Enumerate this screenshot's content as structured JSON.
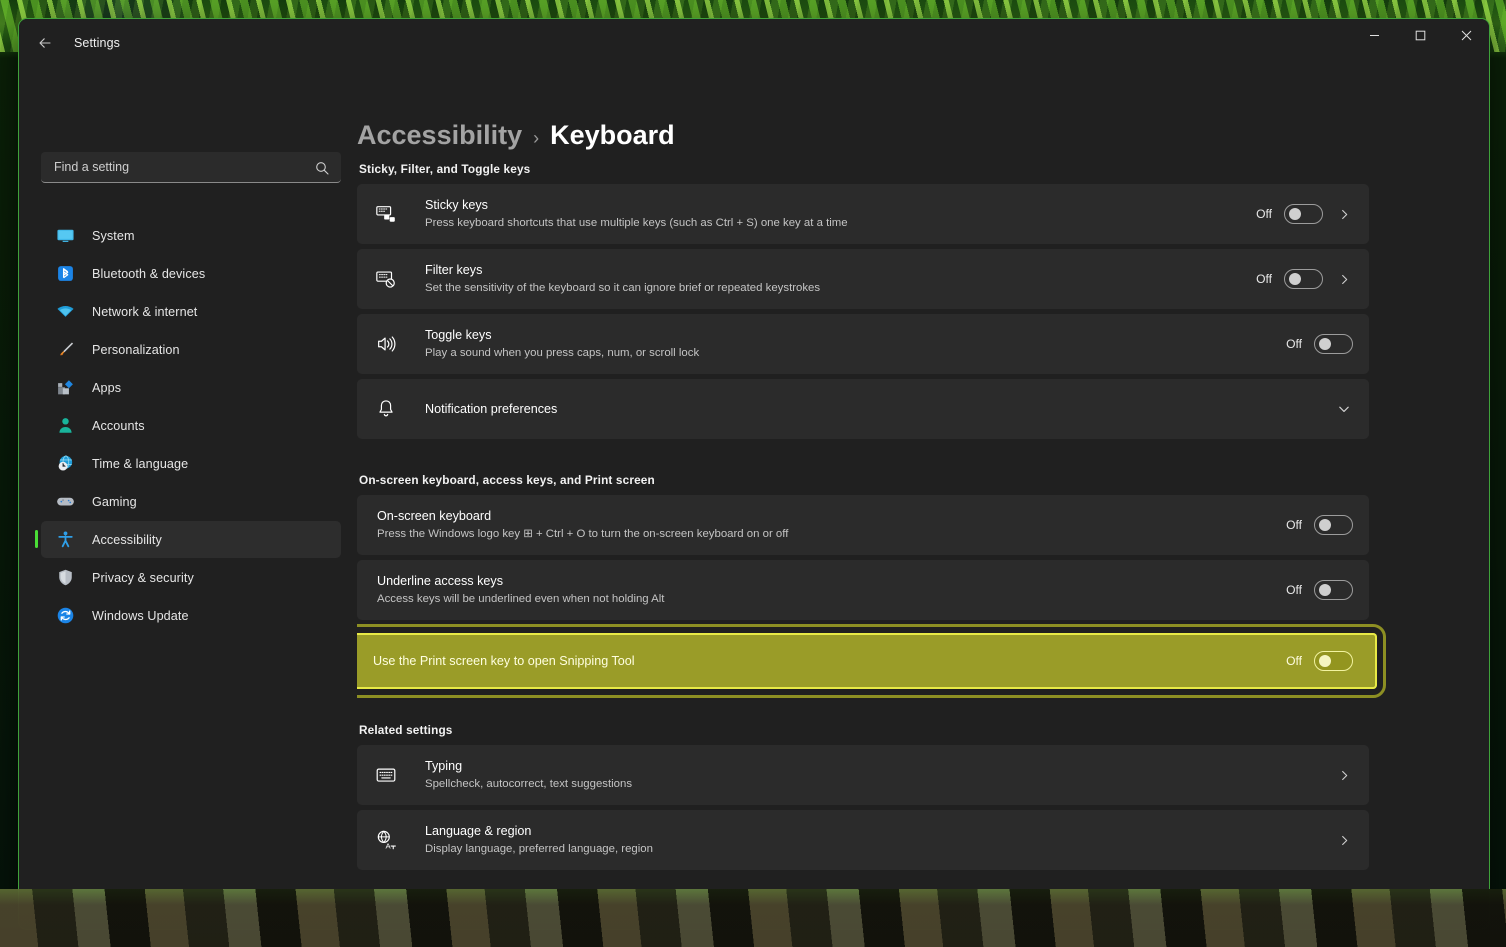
{
  "window": {
    "titlebar_title": "Settings",
    "back_icon": "back-arrow-icon",
    "minimize_label": "—",
    "maximize_label": "□",
    "close_label": "✕",
    "accent_border_color": "#3fa23a"
  },
  "sidebar": {
    "search": {
      "placeholder": "Find a setting",
      "value": "",
      "icon": "search-icon"
    },
    "items": [
      {
        "label": "System",
        "icon": "monitor-icon",
        "selected": false
      },
      {
        "label": "Bluetooth & devices",
        "icon": "bluetooth-icon",
        "selected": false
      },
      {
        "label": "Network & internet",
        "icon": "wifi-icon",
        "selected": false
      },
      {
        "label": "Personalization",
        "icon": "paintbrush-icon",
        "selected": false
      },
      {
        "label": "Apps",
        "icon": "apps-icon",
        "selected": false
      },
      {
        "label": "Accounts",
        "icon": "person-icon",
        "selected": false
      },
      {
        "label": "Time & language",
        "icon": "clock-globe-icon",
        "selected": false
      },
      {
        "label": "Gaming",
        "icon": "gamepad-icon",
        "selected": false
      },
      {
        "label": "Accessibility",
        "icon": "accessibility-icon",
        "selected": true
      },
      {
        "label": "Privacy & security",
        "icon": "shield-icon",
        "selected": false
      },
      {
        "label": "Windows Update",
        "icon": "update-refresh-icon",
        "selected": false
      }
    ]
  },
  "page": {
    "breadcrumb_parent": "Accessibility",
    "breadcrumb_separator": "›",
    "breadcrumb_current": "Keyboard"
  },
  "sections": [
    {
      "title": "Sticky, Filter, and Toggle keys",
      "rows": [
        {
          "title": "Sticky keys",
          "desc": "Press keyboard shortcuts that use multiple keys (such as Ctrl + S) one key at a time",
          "icon": "sticky-keys-keyboard-icon",
          "toggle_state": "Off",
          "has_toggle": true,
          "has_chevron": true,
          "chevron": "chevron-right-icon",
          "highlight": false
        },
        {
          "title": "Filter keys",
          "desc": "Set the sensitivity of the keyboard so it can ignore brief or repeated keystrokes",
          "icon": "filter-keys-keyboard-icon",
          "toggle_state": "Off",
          "has_toggle": true,
          "has_chevron": true,
          "chevron": "chevron-right-icon",
          "highlight": false
        },
        {
          "title": "Toggle keys",
          "desc": "Play a sound when you press caps, num, or scroll lock",
          "icon": "speaker-sound-icon",
          "toggle_state": "Off",
          "has_toggle": true,
          "has_chevron": false,
          "chevron": "",
          "highlight": false
        },
        {
          "title": "Notification preferences",
          "desc": "",
          "icon": "bell-icon",
          "toggle_state": "",
          "has_toggle": false,
          "has_chevron": true,
          "chevron": "chevron-down-icon",
          "highlight": false
        }
      ]
    },
    {
      "title": "On-screen keyboard, access keys, and Print screen",
      "rows": [
        {
          "title": "On-screen keyboard",
          "desc": "Press the Windows logo key ⊞ + Ctrl + O to turn the on-screen keyboard on or off",
          "icon": "",
          "toggle_state": "Off",
          "has_toggle": true,
          "has_chevron": false,
          "chevron": "",
          "highlight": false
        },
        {
          "title": "Underline access keys",
          "desc": "Access keys will be underlined even when not holding Alt",
          "icon": "",
          "toggle_state": "Off",
          "has_toggle": true,
          "has_chevron": false,
          "chevron": "",
          "highlight": false
        },
        {
          "title": "Use the Print screen key to open Snipping Tool",
          "desc": "",
          "icon": "",
          "toggle_state": "Off",
          "has_toggle": true,
          "has_chevron": false,
          "chevron": "",
          "highlight": true
        }
      ]
    },
    {
      "title": "Related settings",
      "rows": [
        {
          "title": "Typing",
          "desc": "Spellcheck, autocorrect, text suggestions",
          "icon": "keyboard-icon",
          "toggle_state": "",
          "has_toggle": false,
          "has_chevron": true,
          "chevron": "chevron-right-icon",
          "highlight": false
        },
        {
          "title": "Language & region",
          "desc": "Display language, preferred language, region",
          "icon": "globe-language-icon",
          "toggle_state": "",
          "has_toggle": false,
          "has_chevron": true,
          "chevron": "chevron-right-icon",
          "highlight": false
        }
      ]
    }
  ],
  "colors": {
    "highlight_row_background": "#9a9c28",
    "highlight_row_border": "#e8ea46",
    "selected_nav_accent": "#4ade36",
    "card_background": "#2b2b2b",
    "window_background": "#202020"
  }
}
